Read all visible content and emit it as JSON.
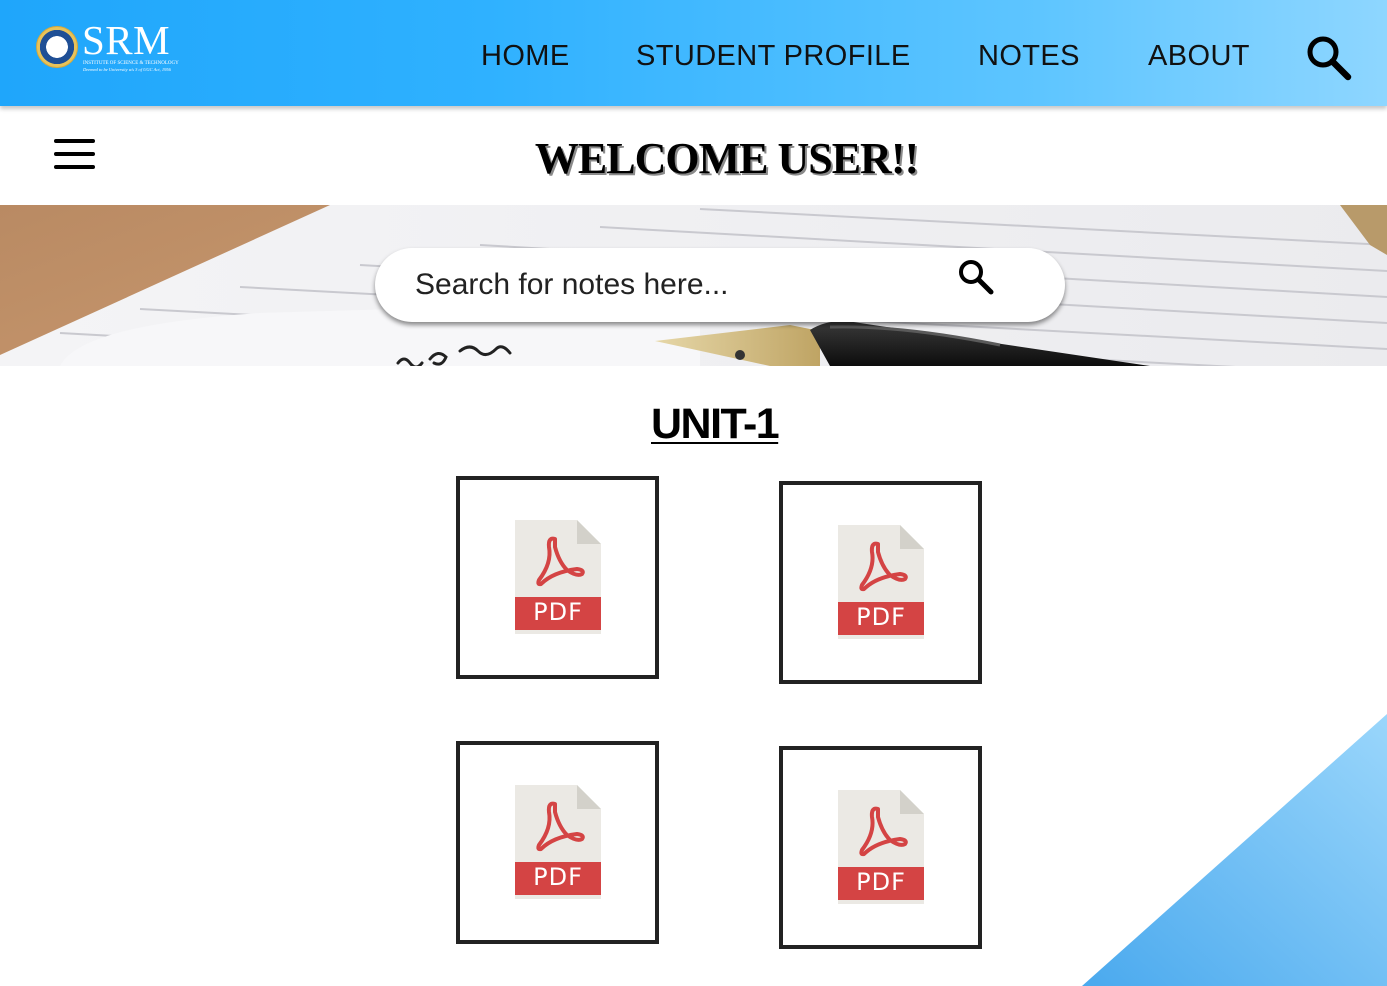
{
  "header": {
    "logo": {
      "text": "SRM",
      "subtitle": "INSTITUTE OF SCIENCE & TECHNOLOGY",
      "tagline": "Deemed to be University u/s 3 of UGC Act, 1956"
    },
    "nav": [
      {
        "label": "HOME"
      },
      {
        "label": "STUDENT PROFILE"
      },
      {
        "label": "NOTES"
      },
      {
        "label": "ABOUT"
      }
    ],
    "search_icon": "search-icon"
  },
  "welcome": {
    "title": "WELCOME USER!!"
  },
  "banner": {
    "search": {
      "placeholder": "Search for notes here...",
      "value": ""
    }
  },
  "content": {
    "section_title": "UNIT-1",
    "files": [
      {
        "label": "PDF",
        "icon": "pdf-file-icon"
      },
      {
        "label": "PDF",
        "icon": "pdf-file-icon"
      },
      {
        "label": "PDF",
        "icon": "pdf-file-icon"
      },
      {
        "label": "PDF",
        "icon": "pdf-file-icon"
      }
    ]
  },
  "colors": {
    "header_gradient_start": "#1fa6fb",
    "header_gradient_end": "#8ed6ff",
    "pdf_red": "#d44444",
    "pdf_page": "#ebe9e4",
    "card_border": "#222222"
  }
}
